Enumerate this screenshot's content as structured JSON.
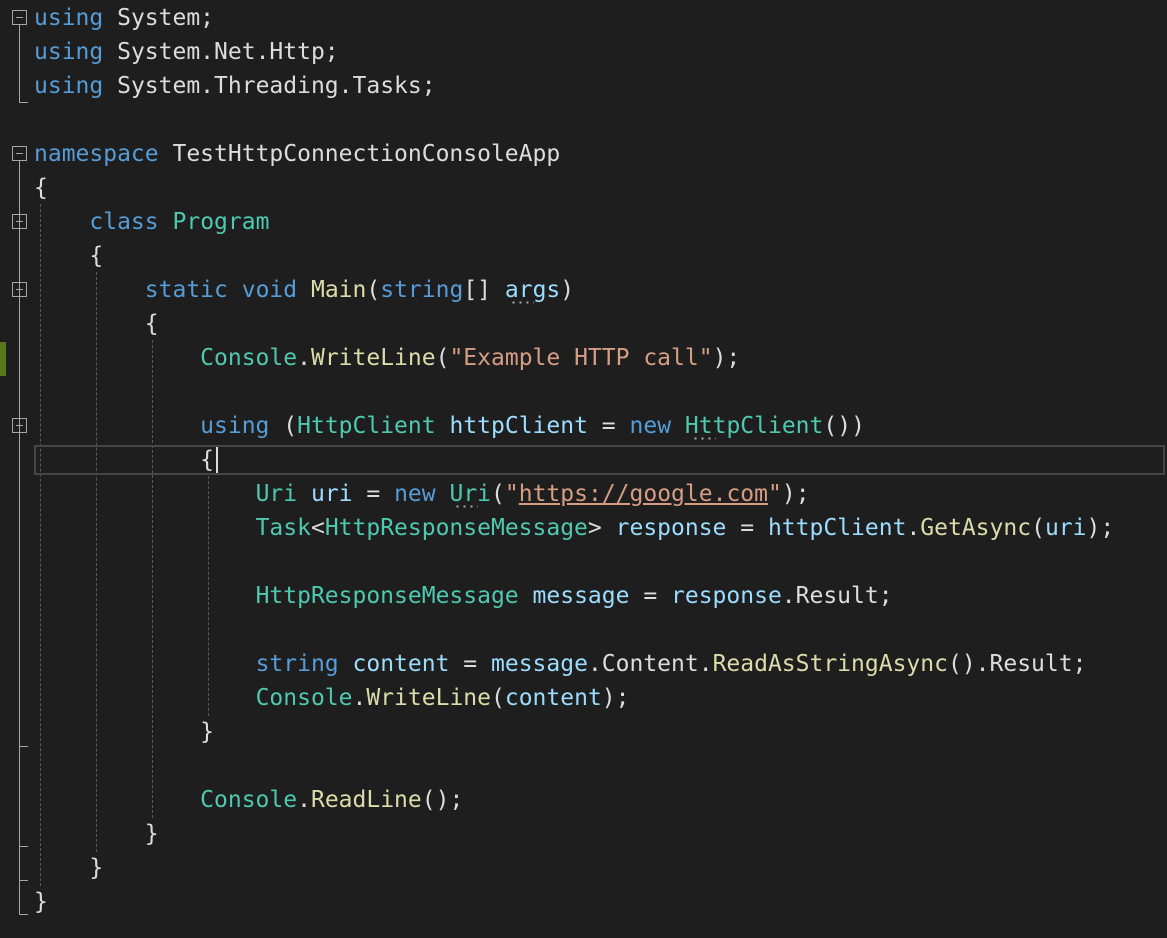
{
  "editor": {
    "lines": [
      {
        "tokens": [
          {
            "t": "using",
            "c": "kw"
          },
          {
            "t": " System;",
            "c": "pl"
          }
        ]
      },
      {
        "tokens": [
          {
            "t": "using",
            "c": "kw"
          },
          {
            "t": " System.Net.Http;",
            "c": "pl"
          }
        ]
      },
      {
        "tokens": [
          {
            "t": "using",
            "c": "kw"
          },
          {
            "t": " System.Threading.Tasks;",
            "c": "pl"
          }
        ]
      },
      {
        "tokens": []
      },
      {
        "tokens": [
          {
            "t": "namespace",
            "c": "kw"
          },
          {
            "t": " TestHttpConnectionConsoleApp",
            "c": "pl"
          }
        ]
      },
      {
        "tokens": [
          {
            "t": "{",
            "c": "pl"
          }
        ]
      },
      {
        "tokens": [
          {
            "t": "    ",
            "c": "pl"
          },
          {
            "t": "class",
            "c": "kw"
          },
          {
            "t": " ",
            "c": "pl"
          },
          {
            "t": "Program",
            "c": "ty"
          }
        ]
      },
      {
        "tokens": [
          {
            "t": "    {",
            "c": "pl"
          }
        ]
      },
      {
        "tokens": [
          {
            "t": "        ",
            "c": "pl"
          },
          {
            "t": "static",
            "c": "kw"
          },
          {
            "t": " ",
            "c": "pl"
          },
          {
            "t": "void",
            "c": "kw"
          },
          {
            "t": " ",
            "c": "pl"
          },
          {
            "t": "Main",
            "c": "fn"
          },
          {
            "t": "(",
            "c": "pl"
          },
          {
            "t": "string",
            "c": "kw"
          },
          {
            "t": "[] ",
            "c": "pl"
          },
          {
            "t": "args",
            "c": "id"
          },
          {
            "t": ")",
            "c": "pl"
          }
        ]
      },
      {
        "tokens": [
          {
            "t": "        {",
            "c": "pl"
          }
        ]
      },
      {
        "tokens": [
          {
            "t": "            ",
            "c": "pl"
          },
          {
            "t": "Console",
            "c": "ty"
          },
          {
            "t": ".",
            "c": "pl"
          },
          {
            "t": "WriteLine",
            "c": "fn"
          },
          {
            "t": "(",
            "c": "pl"
          },
          {
            "t": "\"Example HTTP call\"",
            "c": "st"
          },
          {
            "t": ");",
            "c": "pl"
          }
        ]
      },
      {
        "tokens": []
      },
      {
        "tokens": [
          {
            "t": "            ",
            "c": "pl"
          },
          {
            "t": "using",
            "c": "kw"
          },
          {
            "t": " (",
            "c": "pl"
          },
          {
            "t": "HttpClient",
            "c": "ty"
          },
          {
            "t": " ",
            "c": "pl"
          },
          {
            "t": "httpClient",
            "c": "id"
          },
          {
            "t": " = ",
            "c": "pl"
          },
          {
            "t": "new",
            "c": "kw"
          },
          {
            "t": " ",
            "c": "pl"
          },
          {
            "t": "HttpClient",
            "c": "ty"
          },
          {
            "t": "())",
            "c": "pl"
          }
        ]
      },
      {
        "tokens": [
          {
            "t": "            {",
            "c": "pl"
          }
        ]
      },
      {
        "tokens": [
          {
            "t": "                ",
            "c": "pl"
          },
          {
            "t": "Uri",
            "c": "ty"
          },
          {
            "t": " ",
            "c": "pl"
          },
          {
            "t": "uri",
            "c": "id"
          },
          {
            "t": " = ",
            "c": "pl"
          },
          {
            "t": "new",
            "c": "kw"
          },
          {
            "t": " ",
            "c": "pl"
          },
          {
            "t": "Uri",
            "c": "ty"
          },
          {
            "t": "(",
            "c": "pl"
          },
          {
            "t": "\"",
            "c": "st"
          },
          {
            "t": "https://google.com",
            "c": "lnk"
          },
          {
            "t": "\"",
            "c": "st"
          },
          {
            "t": ");",
            "c": "pl"
          }
        ]
      },
      {
        "tokens": [
          {
            "t": "                ",
            "c": "pl"
          },
          {
            "t": "Task",
            "c": "ty"
          },
          {
            "t": "<",
            "c": "pl"
          },
          {
            "t": "HttpResponseMessage",
            "c": "ty"
          },
          {
            "t": "> ",
            "c": "pl"
          },
          {
            "t": "response",
            "c": "id"
          },
          {
            "t": " = ",
            "c": "pl"
          },
          {
            "t": "httpClient",
            "c": "id"
          },
          {
            "t": ".",
            "c": "pl"
          },
          {
            "t": "GetAsync",
            "c": "fn"
          },
          {
            "t": "(",
            "c": "pl"
          },
          {
            "t": "uri",
            "c": "id"
          },
          {
            "t": ");",
            "c": "pl"
          }
        ]
      },
      {
        "tokens": []
      },
      {
        "tokens": [
          {
            "t": "                ",
            "c": "pl"
          },
          {
            "t": "HttpResponseMessage",
            "c": "ty"
          },
          {
            "t": " ",
            "c": "pl"
          },
          {
            "t": "message",
            "c": "id"
          },
          {
            "t": " = ",
            "c": "pl"
          },
          {
            "t": "response",
            "c": "id"
          },
          {
            "t": ".Result;",
            "c": "pl"
          }
        ]
      },
      {
        "tokens": []
      },
      {
        "tokens": [
          {
            "t": "                ",
            "c": "pl"
          },
          {
            "t": "string",
            "c": "kw"
          },
          {
            "t": " ",
            "c": "pl"
          },
          {
            "t": "content",
            "c": "id"
          },
          {
            "t": " = ",
            "c": "pl"
          },
          {
            "t": "message",
            "c": "id"
          },
          {
            "t": ".Content.",
            "c": "pl"
          },
          {
            "t": "ReadAsStringAsync",
            "c": "fn"
          },
          {
            "t": "().Result;",
            "c": "pl"
          }
        ]
      },
      {
        "tokens": [
          {
            "t": "                ",
            "c": "pl"
          },
          {
            "t": "Console",
            "c": "ty"
          },
          {
            "t": ".",
            "c": "pl"
          },
          {
            "t": "WriteLine",
            "c": "fn"
          },
          {
            "t": "(",
            "c": "pl"
          },
          {
            "t": "content",
            "c": "id"
          },
          {
            "t": ");",
            "c": "pl"
          }
        ]
      },
      {
        "tokens": [
          {
            "t": "            }",
            "c": "pl"
          }
        ]
      },
      {
        "tokens": []
      },
      {
        "tokens": [
          {
            "t": "            ",
            "c": "pl"
          },
          {
            "t": "Console",
            "c": "ty"
          },
          {
            "t": ".",
            "c": "pl"
          },
          {
            "t": "ReadLine",
            "c": "fn"
          },
          {
            "t": "();",
            "c": "pl"
          }
        ]
      },
      {
        "tokens": [
          {
            "t": "        }",
            "c": "pl"
          }
        ]
      },
      {
        "tokens": [
          {
            "t": "    }",
            "c": "pl"
          }
        ]
      },
      {
        "tokens": [
          {
            "t": "}",
            "c": "pl"
          }
        ]
      }
    ]
  },
  "colors": {
    "background": "#1e1e1e",
    "keyword": "#569cd6",
    "type": "#4ec9b0",
    "method": "#dcdcaa",
    "string": "#d69d85",
    "identifier": "#9cdcfe",
    "plain": "#dcdcdc",
    "change_bar": "#57781f"
  }
}
